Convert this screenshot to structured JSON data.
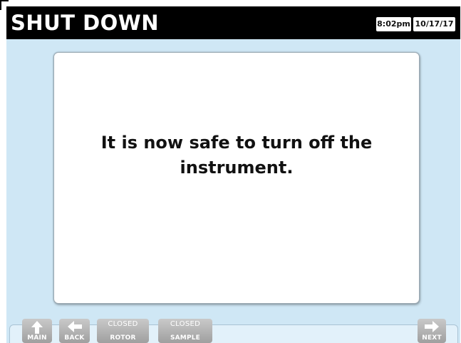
{
  "header": {
    "title": "SHUT DOWN",
    "time": "8:02pm",
    "date": "10/17/17"
  },
  "message": {
    "line1": "It is now safe to turn off the",
    "line2": "instrument."
  },
  "nav": {
    "main_label": "MAIN",
    "back_label": "BACK",
    "rotor_status": "CLOSED",
    "rotor_label": "ROTOR",
    "sample_status": "CLOSED",
    "sample_label": "SAMPLE",
    "next_label": "NEXT",
    "main_icon": "arrow-up-icon",
    "back_icon": "arrow-left-icon",
    "next_icon": "arrow-right-icon"
  },
  "colors": {
    "background": "#cfe7f5",
    "header": "#000000",
    "button": "#b3b3b3"
  }
}
